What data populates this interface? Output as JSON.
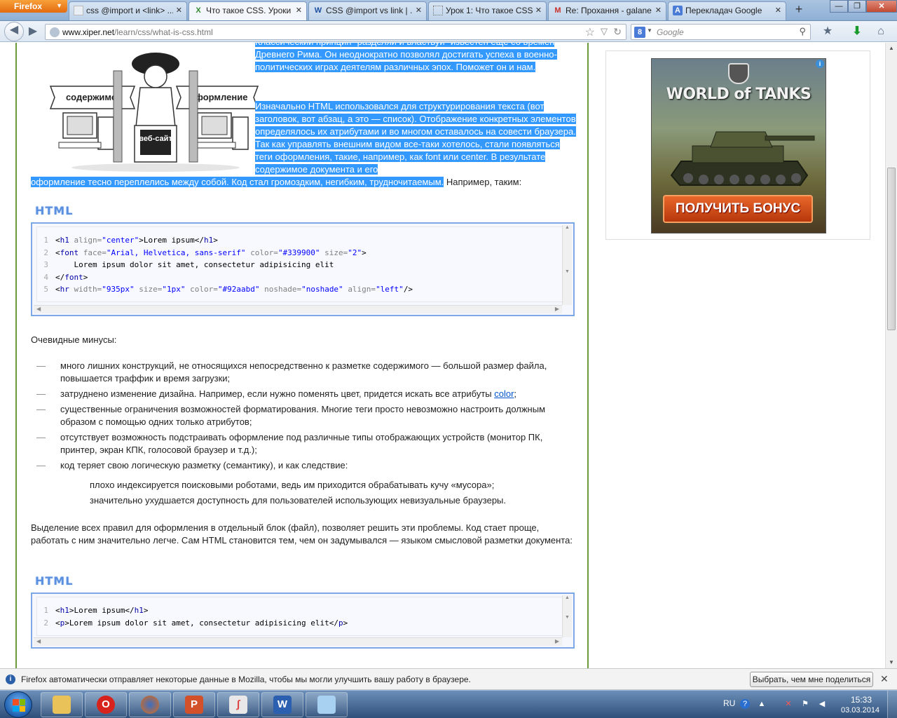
{
  "browser": {
    "menu_label": "Firefox",
    "tabs": [
      {
        "label": "css @import и <link> ...",
        "icon": "page-icon"
      },
      {
        "label": "Что такое CSS. Уроки ...",
        "icon": "xiper-icon",
        "active": true
      },
      {
        "label": "CSS @import vs link | ...",
        "icon": "w-icon"
      },
      {
        "label": "Урок 1: Что такое CSS...",
        "icon": "blank-page-icon"
      },
      {
        "label": "Re: Прохання - galane...",
        "icon": "gmail-icon"
      },
      {
        "label": "Перекладач Google",
        "icon": "google-translate-icon"
      }
    ],
    "url_host": "www.xiper.net",
    "url_path": "/learn/css/what-is-css.html",
    "search_placeholder": "Google",
    "search_engine_letter": "8"
  },
  "article": {
    "intro_para1": "Классический принцип \"разделяй и властвуй\" известен еще со времен Древнего Рима. Он неоднократно позволял достигать успеха в военно-политических играх деятелям различных эпох. Поможет он и нам.",
    "intro_para2_selected_first": "Изначально HTML использовался для структурирования текста (вот заголовок, вот абзац, а это — список). Отображение конкретных элементов определялось их атрибутами и во многом оставалось на совести браузера. Так как управлять внешним видом все-таки хотелось, стали появляться теги оформления, такие, например, как font или center. В результате содержимое документа и его",
    "intro_para2_selected_rest": "оформление тесно переплелись между собой. Код стал громоздким, негибким, трудночитаемым.",
    "intro_para2_tail": " Например, таким:",
    "illustration": {
      "left_label": "содержимое",
      "right_label": "оформление",
      "sign_label": "веб-сайт"
    },
    "code_label": "HTML",
    "code_block_1": {
      "line_numbers": [
        "1",
        "2",
        "3",
        "4",
        "5"
      ]
    },
    "code_block_2": {
      "line_numbers": [
        "1",
        "2"
      ]
    },
    "minuses_title": "Очевидные минусы:",
    "minuses": [
      "много лишних конструкций, не относящихся непосредственно к разметке содержимого — большой размер файла, повышается траффик и время загрузки;",
      "затруднено изменение дизайна. Например, если нужно поменять цвет, придется искать все атрибуты ",
      "существенные ограничения возможностей форматирования. Многие теги просто невозможно настроить должным образом с помощью одних только атрибутов;",
      "отсутствует возможность подстраивать оформление под различные типы отображающих устройств (монитор ПК, принтер, экран КПК, голосовой браузер и т.д.);",
      "код теряет свою логическую разметку (семантику), и как следствие:"
    ],
    "minus_link_text": "color",
    "minus_link_after": ";",
    "sub_points": [
      "плохо индексируется поисковыми роботами, ведь им приходится обрабатывать кучу «мусора»;",
      "значительно ухудшается доступность для пользователей использующих невизуальные браузеры."
    ],
    "conclusion": "Выделение всех правил для оформления в отдельный блок (файл), позволяет решить эти проблемы. Код стает проще, работать с ним значительно легче. Сам HTML становится тем, чем он задумывался — языком смысловой разметки документа:"
  },
  "ad": {
    "title": "WORLD of TANKS",
    "button": "ПОЛУЧИТЬ БОНУС",
    "info_glyph": "i"
  },
  "notification": {
    "text": "Firefox автоматически отправляет некоторые данные в Mozilla, чтобы мы могли улучшить вашу работу в браузере.",
    "button": "Выбрать, чем мне поделиться"
  },
  "taskbar": {
    "items": [
      "explorer-icon",
      "opera-icon",
      "firefox-icon",
      "powerpoint-icon",
      "foxit-icon",
      "word-icon",
      "notepad-icon"
    ],
    "language": "RU",
    "time": "15:33",
    "date": "03.03.2014"
  },
  "colors": {
    "selection": "#3399ff",
    "content_border": "#6a9a3a",
    "code_border": "#7da7e6",
    "link": "#0055cc"
  }
}
